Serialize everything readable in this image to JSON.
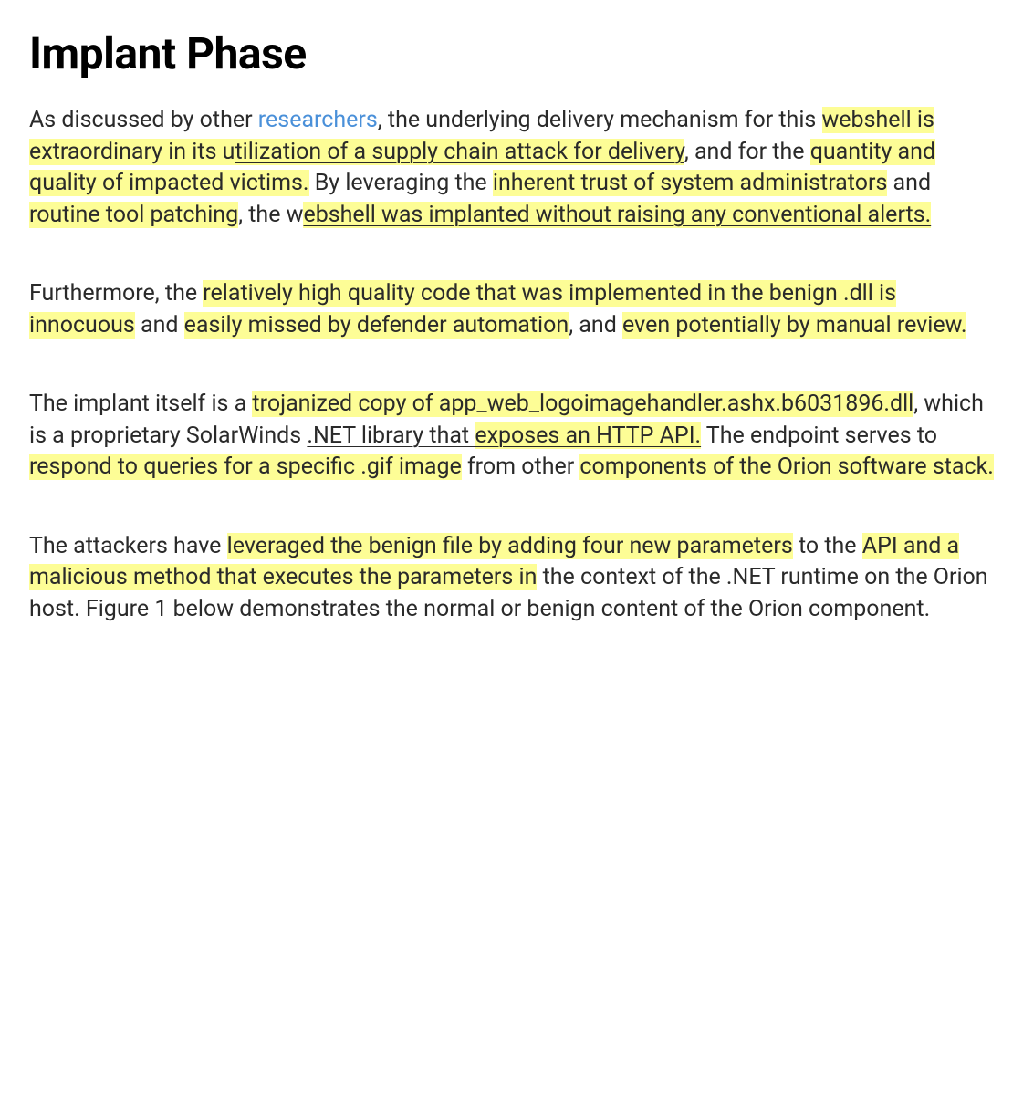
{
  "title": "Implant Phase",
  "paragraphs": {
    "p1": {
      "s1": "As discussed by other ",
      "link": "researchers",
      "s2": ", the underlying delivery mechanism for this ",
      "h1": "webshell is extraordinary in its u",
      "uh1": "tilization of a supply chain attack for delivery",
      "s3": ", and for the ",
      "h2": "quantity and quality of impacted victims.",
      "s4": " By leveraging the ",
      "h3": "inherent trust of system administrators",
      "s5": " and ",
      "h4": "routine tool patching",
      "s6": ", the w",
      "uh2": "ebshell was implanted without raising any conventional alerts."
    },
    "p2": {
      "s1": "Furthermore, the ",
      "h1": "relatively high quality code that was implemented in the benign .dll is innocuous",
      "s2": " and ",
      "h2": "easily missed by defender automation",
      "s3": ", and ",
      "h3": "even potentially by manual review."
    },
    "p3": {
      "s1": "The implant itself is a ",
      "h1": "trojanized copy of app_web_logoimagehandler.ashx.b6031896.dll",
      "s2": ", which is a proprietary SolarWinds ",
      "uh1": ".NET library that ",
      "h2": "exposes an HTTP API.",
      "s3": " The endpoint serves to ",
      "h3": "respond to queries for a specific .gif image",
      "s4": " from other ",
      "h4": "components of the Orion software stack."
    },
    "p4": {
      "s1": "The attackers have ",
      "h1": "leveraged the benign file by adding four new parameters",
      "s2": " to the ",
      "h2": "API and a malicious method that executes the parameters in",
      "s3": " the context of the .NET runtime on the Orion host. Figure 1 below demonstrates the normal or benign content of the Orion component."
    }
  }
}
